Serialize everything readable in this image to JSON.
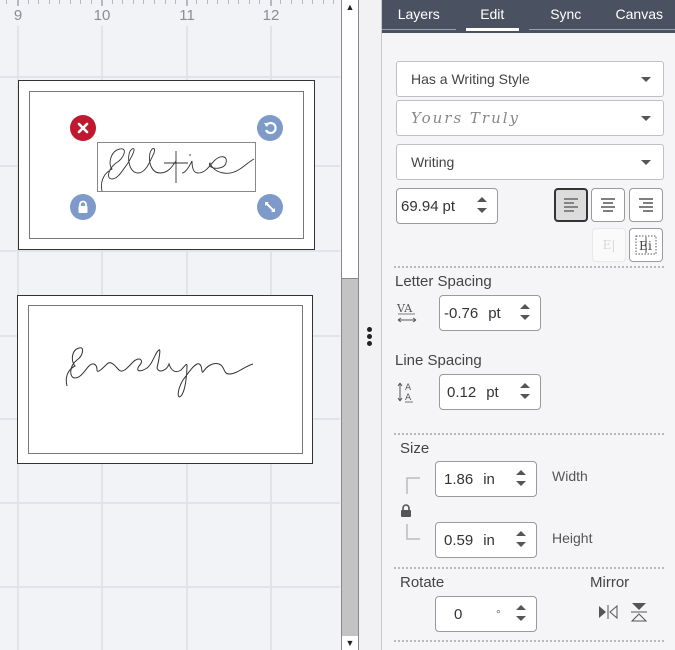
{
  "canvas": {
    "ruler": {
      "labels": [
        "9",
        "10",
        "11",
        "12"
      ],
      "unit": "in"
    },
    "cards": [
      {
        "name": "Ellie",
        "selected": true
      },
      {
        "name": "Evelyn",
        "selected": false
      }
    ],
    "selection_handles": {
      "delete": "delete-icon",
      "rotate": "rotate-icon",
      "lock": "lock-icon",
      "scale": "resize-icon"
    },
    "colors": {
      "delete_handle": "#c0192f",
      "other_handles": "#7d9ac9",
      "background": "#f2f3f7"
    }
  },
  "panel": {
    "tabs": [
      {
        "label": "Layers",
        "active": false
      },
      {
        "label": "Edit",
        "active": true
      },
      {
        "label": "Sync",
        "active": false
      },
      {
        "label": "Canvas",
        "active": false
      }
    ],
    "font_filter": "Has a Writing Style",
    "font_name": "Yours Truly",
    "font_style": "Writing",
    "font_size": {
      "value": "69.94",
      "unit": "pt"
    },
    "alignment": {
      "options": [
        "align-left",
        "align-center",
        "align-right"
      ],
      "selected": "align-left"
    },
    "letter_spacing": {
      "label": "Letter Spacing",
      "value": "-0.76",
      "unit": "pt"
    },
    "line_spacing": {
      "label": "Line Spacing",
      "value": "0.12",
      "unit": "pt"
    },
    "size": {
      "label": "Size",
      "width": {
        "value": "1.86",
        "unit": "in",
        "label": "Width"
      },
      "height": {
        "value": "0.59",
        "unit": "in",
        "label": "Height"
      },
      "locked": true
    },
    "rotate": {
      "label": "Rotate",
      "value": "0",
      "unit": "°"
    },
    "mirror": {
      "label": "Mirror"
    },
    "tab_bar_color": "#4a5160"
  }
}
